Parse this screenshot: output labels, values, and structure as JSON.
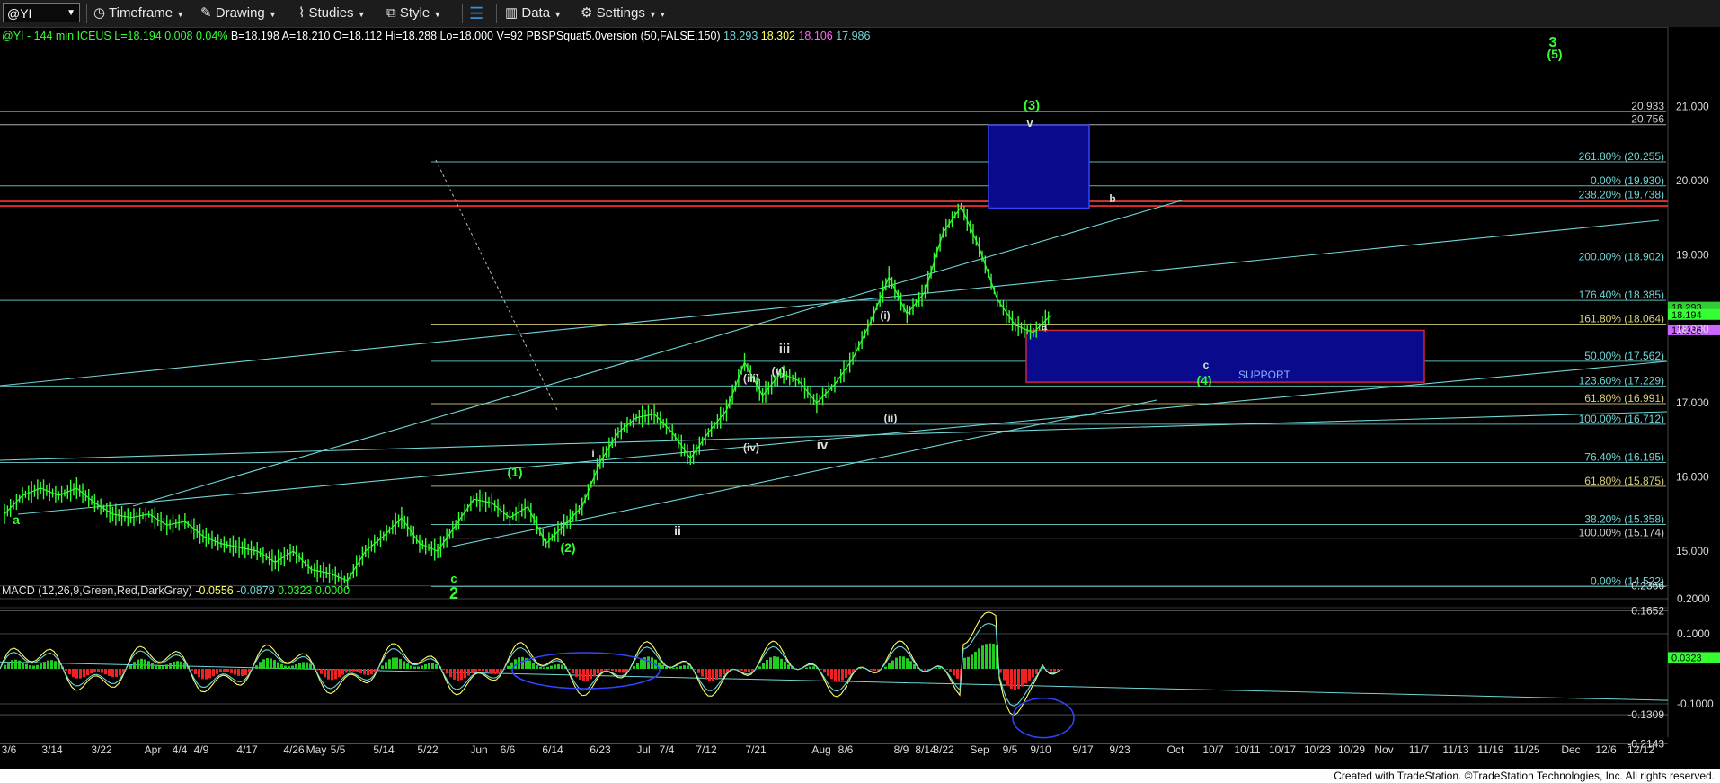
{
  "toolbar": {
    "symbol": "@YI",
    "timeframe": "Timeframe",
    "drawing": "Drawing",
    "studies": "Studies",
    "style": "Style",
    "data": "Data",
    "settings": "Settings"
  },
  "header": {
    "symbol": "@YI - 144 min",
    "exchange": "ICEUS",
    "last": "L=18.194",
    "change": "0.008",
    "pct": "0.04%",
    "bid": "B=18.198",
    "ask": "A=18.210",
    "open": "O=18.112",
    "high": "Hi=18.288",
    "low": "Lo=18.000",
    "volume": "V=92",
    "study": "PBSPSquat5.0version (50,FALSE,150)",
    "study_values": [
      "18.293",
      "18.302",
      "18.106",
      "17.986"
    ]
  },
  "macd_header": {
    "label": "MACD (12,26,9,Green,Red,DarkGray)",
    "values": [
      "-0.0556",
      "-0.0879",
      "0.0323",
      "0.0000"
    ]
  },
  "footer": "Created with TradeStation. ©TradeStation Technologies, Inc. All rights reserved.",
  "colors": {
    "bg": "#000000",
    "price": "#33ff33",
    "teal": "#6fd6d6",
    "white": "#ffffff",
    "olive": "#d8d080",
    "blue_box": "#0a0a8c",
    "red_line": "#ff3333",
    "green_label": "#22cc22"
  },
  "chart_data": {
    "type": "line",
    "price_axis": {
      "ticks": [
        "21.000",
        "20.000",
        "19.000",
        "18.000",
        "17.000",
        "16.000",
        "15.000"
      ]
    },
    "current_price_labels": [
      "18.293",
      "18.194",
      "17.986"
    ],
    "x_labels": [
      "3/6",
      "3/14",
      "3/22",
      "Apr",
      "4/4",
      "4/9",
      "4/17",
      "4/26",
      "May",
      "5/5",
      "5/14",
      "5/22",
      "Jun",
      "6/6",
      "6/14",
      "6/23",
      "Jul",
      "7/4",
      "7/12",
      "7/21",
      "Aug",
      "8/6",
      "8/9",
      "8/14",
      "8/22",
      "Sep",
      "9/5",
      "9/10",
      "9/17",
      "9/23",
      "Oct",
      "10/7",
      "10/11",
      "10/17",
      "10/23",
      "10/29",
      "Nov",
      "11/7",
      "11/13",
      "11/19",
      "11/25",
      "Dec",
      "12/6",
      "12/12"
    ],
    "price_series": [
      [
        "3/6",
        15.5
      ],
      [
        "3/10",
        15.75
      ],
      [
        "3/14",
        15.85
      ],
      [
        "3/18",
        15.75
      ],
      [
        "3/22",
        15.85
      ],
      [
        "3/26",
        15.65
      ],
      [
        "4/1",
        15.5
      ],
      [
        "4/4",
        15.45
      ],
      [
        "4/9",
        15.5
      ],
      [
        "4/14",
        15.35
      ],
      [
        "4/17",
        15.4
      ],
      [
        "4/22",
        15.2
      ],
      [
        "4/26",
        15.1
      ],
      [
        "5/1",
        15.05
      ],
      [
        "5/5",
        15.0
      ],
      [
        "5/10",
        14.85
      ],
      [
        "5/14",
        15.0
      ],
      [
        "5/18",
        14.75
      ],
      [
        "5/22",
        14.7
      ],
      [
        "5/27",
        14.6
      ],
      [
        "5/31",
        15.0
      ],
      [
        "6/3",
        15.2
      ],
      [
        "6/6",
        15.45
      ],
      [
        "6/10",
        15.1
      ],
      [
        "6/14",
        15.0
      ],
      [
        "6/18",
        15.35
      ],
      [
        "6/20",
        15.7
      ],
      [
        "6/23",
        15.65
      ],
      [
        "6/27",
        15.45
      ],
      [
        "7/1",
        15.6
      ],
      [
        "7/4",
        15.1
      ],
      [
        "7/8",
        15.35
      ],
      [
        "7/12",
        15.6
      ],
      [
        "7/15",
        16.2
      ],
      [
        "7/18",
        16.6
      ],
      [
        "7/21",
        16.8
      ],
      [
        "7/25",
        16.85
      ],
      [
        "7/29",
        16.6
      ],
      [
        "8/1",
        16.25
      ],
      [
        "8/3",
        16.6
      ],
      [
        "8/6",
        16.9
      ],
      [
        "8/8",
        17.55
      ],
      [
        "8/9",
        17.1
      ],
      [
        "8/12",
        17.4
      ],
      [
        "8/14",
        17.3
      ],
      [
        "8/16",
        17.0
      ],
      [
        "8/19",
        17.25
      ],
      [
        "8/22",
        17.6
      ],
      [
        "8/24",
        18.1
      ],
      [
        "8/26",
        18.7
      ],
      [
        "8/28",
        18.2
      ],
      [
        "8/30",
        18.5
      ],
      [
        "9/2",
        19.3
      ],
      [
        "9/3",
        19.65
      ],
      [
        "9/5",
        19.1
      ],
      [
        "9/6",
        18.4
      ],
      [
        "9/8",
        18.05
      ],
      [
        "9/9",
        17.95
      ],
      [
        "9/10",
        18.19
      ]
    ],
    "fib_levels": [
      {
        "label": "20.933",
        "value": 20.933
      },
      {
        "label": "20.756",
        "value": 20.756
      },
      {
        "label": "261.80% (20.255)",
        "value": 20.255
      },
      {
        "label": "0.00% (19.930)",
        "value": 19.93
      },
      {
        "label": "238.20% (19.738)",
        "value": 19.738
      },
      {
        "label": "200.00% (18.902)",
        "value": 18.902
      },
      {
        "label": "176.40% (18.385)",
        "value": 18.385
      },
      {
        "label": "161.80% (18.064)",
        "value": 18.064
      },
      {
        "label": "50.00% (17.562)",
        "value": 17.562
      },
      {
        "label": "123.60% (17.229)",
        "value": 17.229
      },
      {
        "label": "61.80% (16.991)",
        "value": 16.991
      },
      {
        "label": "100.00% (16.712)",
        "value": 16.712
      },
      {
        "label": "76.40% (16.195)",
        "value": 16.195
      },
      {
        "label": "61.80% (15.875)",
        "value": 15.875
      },
      {
        "label": "38.20% (15.358)",
        "value": 15.358
      },
      {
        "label": "100.00% (15.174)",
        "value": 15.174
      },
      {
        "label": "0.00% (14.522)",
        "value": 14.522
      }
    ],
    "support_label": "SUPPORT",
    "wave_labels": [
      "a",
      "c",
      "2",
      "(1)",
      "(2)",
      "i",
      "ii",
      "iii",
      "iv",
      "(i)",
      "(ii)",
      "(iii)",
      "(iv)",
      "(v)",
      "(3)",
      "v",
      "b",
      "a",
      "c",
      "(4)",
      "3",
      "(5)"
    ],
    "macd": {
      "ticks": [
        "0.2366",
        "0.2000",
        "0.1652",
        "0.1000",
        "-0.1000",
        "-0.1309",
        "-0.2143"
      ],
      "current": "0.0323"
    }
  }
}
